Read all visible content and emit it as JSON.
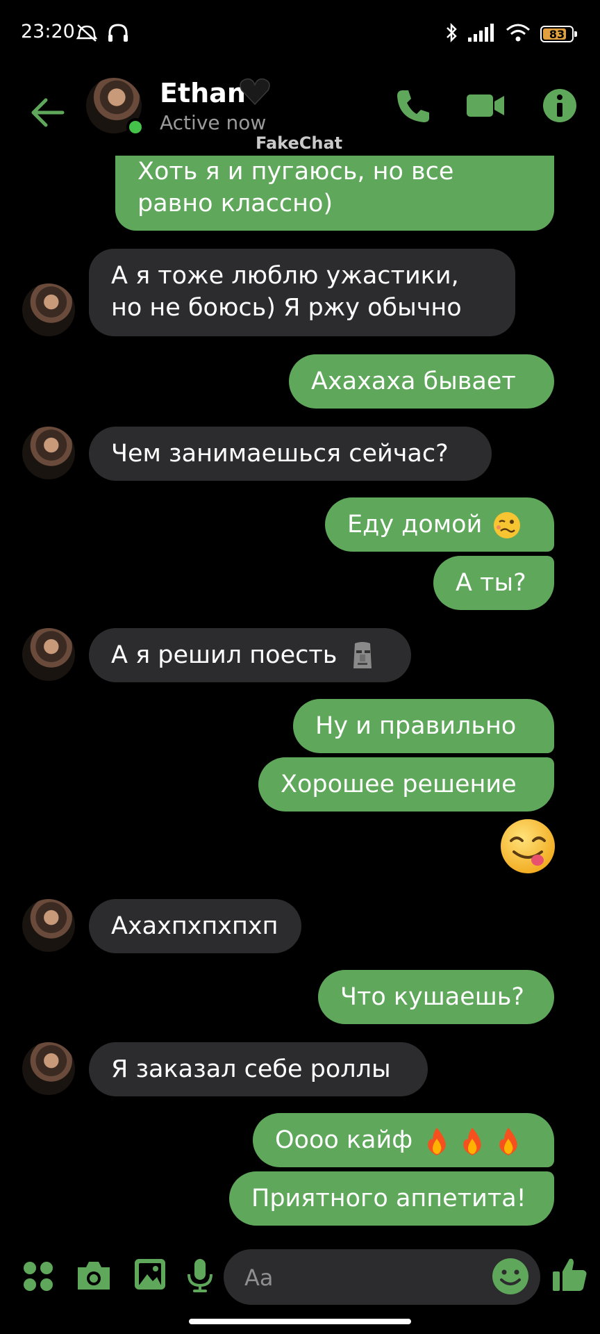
{
  "status_bar": {
    "time": "23:20",
    "battery": "83",
    "battery_level_percent": 83
  },
  "header": {
    "name": "Ethan",
    "status": "Active now",
    "watermark": "FakeChat",
    "icons": [
      "back-arrow-icon",
      "phone-icon",
      "video-camera-icon",
      "info-icon"
    ]
  },
  "messages": [
    {
      "dir": "out",
      "lines": [
        "Хоть я и пугаюсь, но все",
        "равно классно)"
      ]
    },
    {
      "dir": "in",
      "lines": [
        "А я тоже люблю ужастики,",
        "но не боюсь) Я ржу обычно"
      ]
    },
    {
      "dir": "out",
      "lines": [
        "Ахахаха бывает"
      ]
    },
    {
      "dir": "in",
      "lines": [
        "Чем занимаешься сейчас?"
      ]
    },
    {
      "dir": "out",
      "lines": [
        "Еду домой"
      ],
      "emoji": "woozy-face"
    },
    {
      "dir": "out",
      "lines": [
        "А ты?"
      ]
    },
    {
      "dir": "in",
      "lines": [
        "А я решил поесть"
      ],
      "emoji": "moai"
    },
    {
      "dir": "out",
      "lines": [
        "Ну и правильно"
      ]
    },
    {
      "dir": "out",
      "lines": [
        "Хорошее решение"
      ]
    },
    {
      "dir": "out",
      "emoji": "yum-face"
    },
    {
      "dir": "in",
      "lines": [
        "Ахахпхпхпхп"
      ]
    },
    {
      "dir": "out",
      "lines": [
        "Что кушаешь?"
      ]
    },
    {
      "dir": "in",
      "lines": [
        "Я заказал себе роллы"
      ]
    },
    {
      "dir": "out",
      "lines": [
        "Оооо кайф"
      ],
      "emoji": "fire-x3"
    },
    {
      "dir": "out",
      "lines": [
        "Приятного аппетита!"
      ]
    }
  ],
  "composer": {
    "placeholder": "Aa",
    "icons": [
      "apps-icon",
      "camera-icon",
      "gallery-icon",
      "mic-icon",
      "emoji-icon",
      "thumbs-up-icon"
    ]
  },
  "colors": {
    "accent": "#5fa85b",
    "incoming_bubble": "#2c2c2e",
    "background": "#000000",
    "online": "#44c24a"
  }
}
